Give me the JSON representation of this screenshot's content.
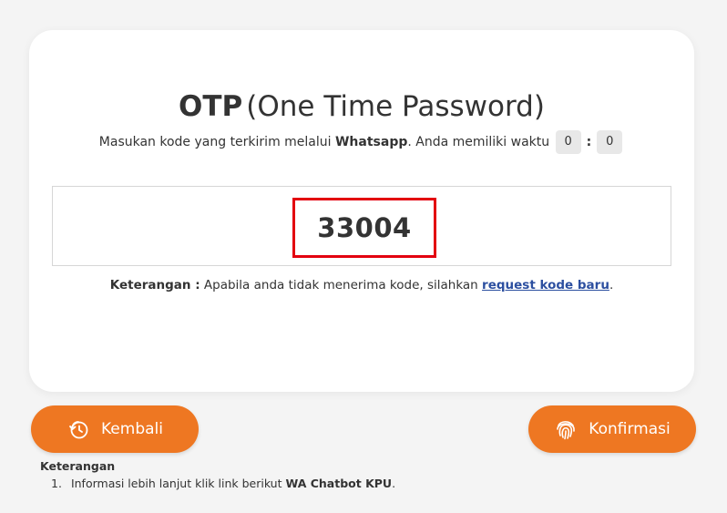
{
  "otp": {
    "title_strong": "OTP",
    "title_rest": "(One Time Password)",
    "subtitle_prefix": "Masukan kode yang terkirim melalui",
    "subtitle_channel": "Whatsapp",
    "subtitle_suffix": ". Anda memiliki waktu",
    "timer_minutes": "0",
    "timer_separator": ":",
    "timer_seconds": "0",
    "code": "33004",
    "note_label": "Keterangan :",
    "note_text": "Apabila anda tidak menerima kode, silahkan",
    "note_link": "request kode baru",
    "note_end": ".",
    "highlight_color": "#e3000f"
  },
  "buttons": {
    "back_label": "Kembali",
    "back_icon": "history-clock-icon",
    "confirm_label": "Konfirmasi",
    "confirm_icon": "fingerprint-icon",
    "color": "#ee7722"
  },
  "footer": {
    "title": "Keterangan",
    "items": [
      {
        "num": "1.",
        "text": "Informasi lebih lanjut klik link berikut",
        "link": "WA Chatbot KPU",
        "end": "."
      }
    ]
  }
}
